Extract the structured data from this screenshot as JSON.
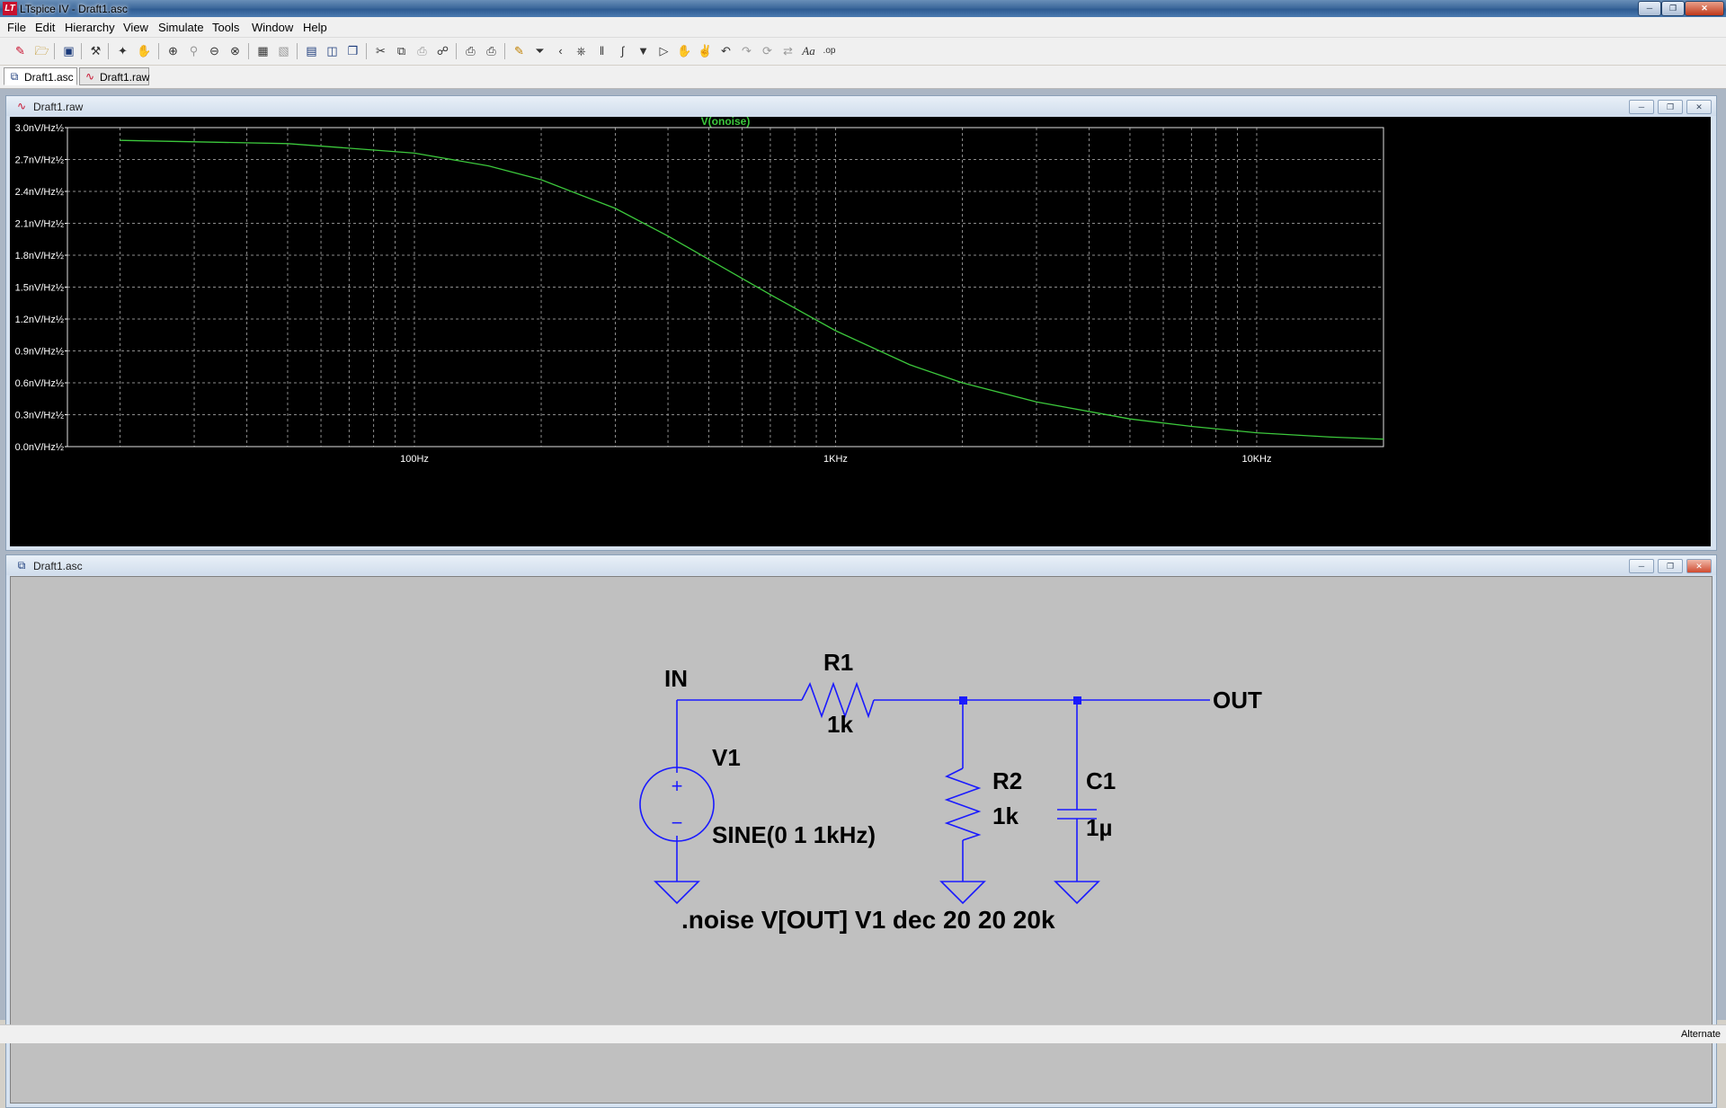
{
  "window": {
    "title": "LTspice IV - Draft1.asc",
    "app_icon_text": "LT"
  },
  "menu": [
    "File",
    "Edit",
    "Hierarchy",
    "View",
    "Simulate",
    "Tools",
    "Window",
    "Help"
  ],
  "toolbar_icons": [
    "new-schematic-icon",
    "open-icon",
    "save-icon",
    "control-panel-icon",
    "run-icon",
    "halt-icon",
    "zoom-in-icon",
    "zoom-area-icon",
    "zoom-out-icon",
    "zoom-fit-icon",
    "autorange-icon",
    "delete-trace-icon",
    "tile-horizontal-icon",
    "tile-vertical-icon",
    "cascade-icon",
    "cut-icon",
    "copy-icon",
    "paste-icon",
    "find-icon",
    "print-preview-icon",
    "print-icon",
    "wire-icon",
    "ground-icon",
    "label-net-icon",
    "resistor-icon",
    "capacitor-icon",
    "inductor-icon",
    "diode-icon",
    "component-icon",
    "move-icon",
    "drag-icon",
    "undo-icon",
    "redo-icon",
    "rotate-icon",
    "mirror-icon",
    "text-icon",
    "spice-directive-icon"
  ],
  "tabs": [
    {
      "label": "Draft1.asc",
      "icon": "schematic-icon",
      "active": true
    },
    {
      "label": "Draft1.raw",
      "icon": "waveform-icon",
      "active": false
    }
  ],
  "plot_window": {
    "title": "Draft1.raw"
  },
  "schematic_window": {
    "title": "Draft1.asc"
  },
  "chart_data": {
    "type": "line",
    "title": "",
    "xlabel": "",
    "ylabel": "",
    "x_scale": "log",
    "xlim": [
      15,
      20000
    ],
    "ylim": [
      0,
      3.0
    ],
    "background": "#000000",
    "grid": true,
    "grid_color": "#8c8c8c",
    "y_ticks": [
      "0.0nV/Hz½",
      "0.3nV/Hz½",
      "0.6nV/Hz½",
      "0.9nV/Hz½",
      "1.2nV/Hz½",
      "1.5nV/Hz½",
      "1.8nV/Hz½",
      "2.1nV/Hz½",
      "2.4nV/Hz½",
      "2.7nV/Hz½",
      "3.0nV/Hz½"
    ],
    "x_ticks": [
      "100Hz",
      "1KHz",
      "10KHz"
    ],
    "series": [
      {
        "name": "V(onoise)",
        "color": "#3cc83c",
        "x": [
          20,
          50,
          100,
          150,
          200,
          300,
          400,
          500,
          700,
          1000,
          1500,
          2000,
          3000,
          5000,
          7000,
          10000,
          15000,
          20000
        ],
        "y": [
          2.88,
          2.85,
          2.76,
          2.64,
          2.51,
          2.24,
          1.98,
          1.76,
          1.43,
          1.09,
          0.77,
          0.6,
          0.42,
          0.26,
          0.19,
          0.13,
          0.09,
          0.07
        ]
      }
    ]
  },
  "schematic": {
    "line_color": "#0000ff",
    "labels": {
      "in": "IN",
      "out": "OUT",
      "r1_name": "R1",
      "r1_value": "1k",
      "r2_name": "R2",
      "r2_value": "1k",
      "c1_name": "C1",
      "c1_value": "1µ",
      "v1_name": "V1",
      "v1_value": "SINE(0 1 1kHz)",
      "directive": ".noise V[OUT] V1 dec 20 20 20k",
      "plus": "+",
      "minus": "−"
    }
  },
  "status": {
    "mode": "Alternate"
  }
}
